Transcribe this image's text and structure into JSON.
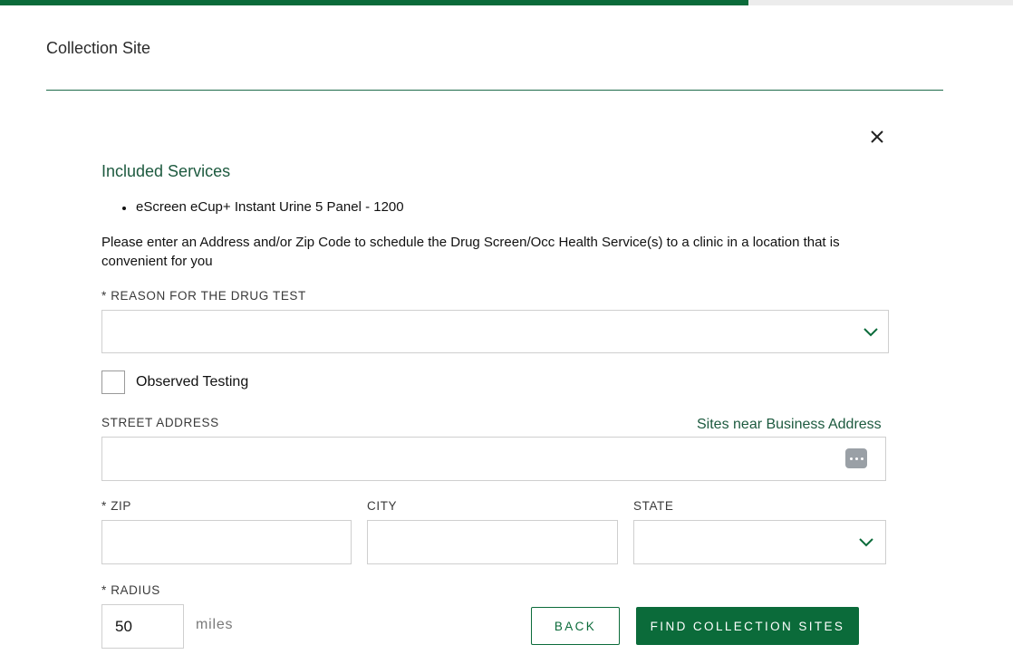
{
  "progress": {
    "fraction": 0.739
  },
  "header": {
    "title": "Collection Site"
  },
  "services": {
    "title": "Included Services",
    "items": [
      "eScreen eCup+ Instant Urine 5 Panel - 1200"
    ]
  },
  "instructions": "Please enter an Address and/or Zip Code to schedule the Drug Screen/Occ Health Service(s) to a clinic in a location that is convenient for you",
  "form": {
    "reason_label": "* REASON FOR THE DRUG TEST",
    "reason_value": "",
    "observed_label": "Observed Testing",
    "observed_checked": false,
    "street_label": "STREET ADDRESS",
    "street_value": "",
    "business_link": "Sites near Business Address",
    "zip_label": "* ZIP",
    "zip_value": "",
    "city_label": "CITY",
    "city_value": "",
    "state_label": "STATE",
    "state_value": "",
    "radius_label": "* RADIUS",
    "radius_value": "50",
    "radius_unit": "miles"
  },
  "actions": {
    "back_label": "BACK",
    "find_label": "FIND COLLECTION SITES"
  },
  "colors": {
    "accent": "#0b6b3a",
    "heading_green": "#1d5a3f",
    "border": "#cfcfcf"
  },
  "icons": [
    "close-icon",
    "chevron-down-icon",
    "more-dots-icon"
  ]
}
